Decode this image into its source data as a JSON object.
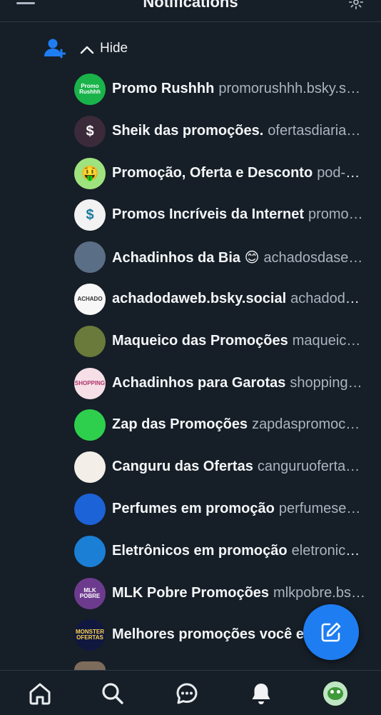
{
  "header": {
    "title": "Notifications",
    "menu_icon": "hamburger-menu-icon",
    "settings_icon": "gear-icon"
  },
  "follow_group": {
    "hide_label": "Hide",
    "icon": "add-user-icon"
  },
  "accent_color": "#1f7df2",
  "accounts": [
    {
      "name": "Promo Rushhh",
      "handle": "promorushhh.bsky.s…",
      "avatar_text": "Promo Rushhh",
      "avatar_bg": "#19b34a",
      "avatar_fg": "#ffffff"
    },
    {
      "name": "Sheik das promoções.",
      "handle": "ofertasdiaria…",
      "avatar_text": "$",
      "avatar_bg": "#3a2a3a",
      "avatar_fg": "#ffffff"
    },
    {
      "name": "Promoção, Oferta e Desconto",
      "handle": "pod-o…",
      "avatar_text": "🤑",
      "avatar_bg": "#9fe37e",
      "avatar_fg": "#1a1a1a"
    },
    {
      "name": "Promos Incríveis da Internet",
      "handle": "promo…",
      "avatar_text": "$",
      "avatar_bg": "#f2f2f2",
      "avatar_fg": "#1a7a9c"
    },
    {
      "name": "Achadinhos da Bia 😊",
      "handle": "achadosdase…",
      "avatar_text": "",
      "avatar_bg": "#5a6e86",
      "avatar_fg": "#ffffff"
    },
    {
      "name": "achadodaweb.bsky.social",
      "handle": "achadoda…",
      "avatar_text": "ACHADO",
      "avatar_bg": "#f7f7f7",
      "avatar_fg": "#333333"
    },
    {
      "name": "Maqueico das Promoções",
      "handle": "maqueic…",
      "avatar_text": "",
      "avatar_bg": "#6a7a3a",
      "avatar_fg": "#ffffff"
    },
    {
      "name": "Achadinhos para Garotas",
      "handle": "shopping…",
      "avatar_text": "SHOPPING",
      "avatar_bg": "#f6dfe6",
      "avatar_fg": "#b0326a"
    },
    {
      "name": "Zap das Promoções",
      "handle": "zapdaspromoc…",
      "avatar_text": "",
      "avatar_bg": "#2fcf4e",
      "avatar_fg": "#0b2a12"
    },
    {
      "name": "Canguru das Ofertas",
      "handle": "canguruoferta…",
      "avatar_text": "",
      "avatar_bg": "#f3efe8",
      "avatar_fg": "#b06a2a"
    },
    {
      "name": "Perfumes em promoção",
      "handle": "perfumese…",
      "avatar_text": "",
      "avatar_bg": "#1d63d8",
      "avatar_fg": "#ffffff"
    },
    {
      "name": "Eletrônicos em promoção",
      "handle": "eletronico…",
      "avatar_text": "",
      "avatar_bg": "#1b7fd6",
      "avatar_fg": "#ffffff"
    },
    {
      "name": "MLK Pobre Promoções",
      "handle": "mlkpobre.bs…",
      "avatar_text": "MLK POBRE",
      "avatar_bg": "#6d3b8e",
      "avatar_fg": "#ffffff"
    },
    {
      "name": "Melhores promoções você e…",
      "handle": "",
      "avatar_text": "MONSTER OFERTAS",
      "avatar_bg": "#101840",
      "avatar_fg": "#ffd34a"
    }
  ],
  "fab": {
    "icon": "compose-icon"
  },
  "tabbar": {
    "items": [
      {
        "name": "home",
        "icon": "home-icon"
      },
      {
        "name": "search",
        "icon": "search-icon"
      },
      {
        "name": "messages",
        "icon": "chat-bubble-icon"
      },
      {
        "name": "notifications",
        "icon": "bell-icon"
      },
      {
        "name": "profile",
        "icon": "avatar"
      }
    ]
  }
}
